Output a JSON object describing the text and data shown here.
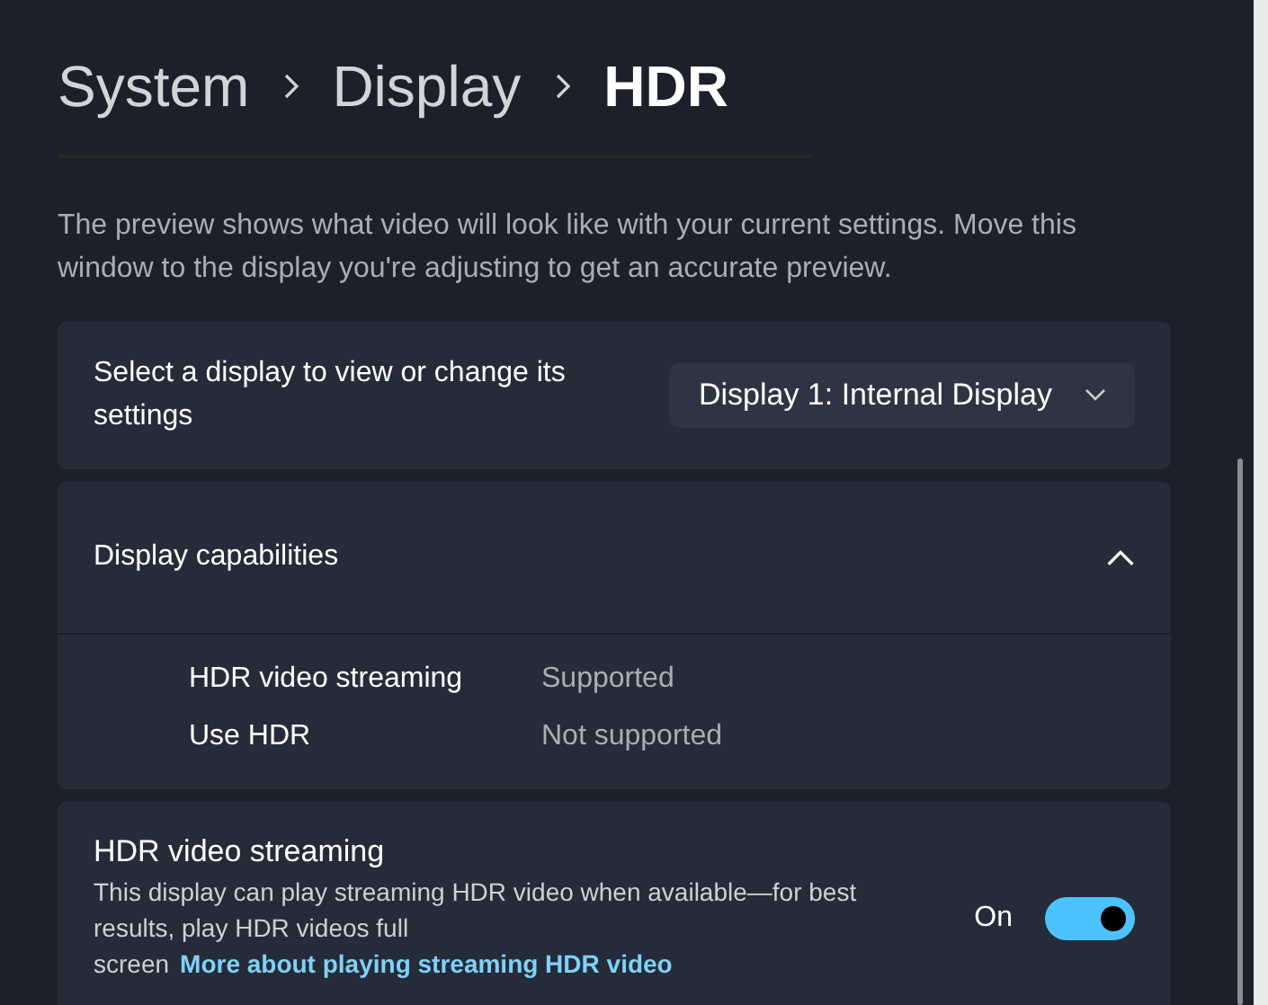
{
  "breadcrumb": [
    {
      "label": "System",
      "current": false
    },
    {
      "label": "Display",
      "current": false
    },
    {
      "label": "HDR",
      "current": true
    }
  ],
  "description": "The preview shows what video will look like with your current settings. Move this window to the display you're adjusting to get an accurate preview.",
  "display_select": {
    "label": "Select a display to view or change its settings",
    "value": "Display 1: Internal Display"
  },
  "capabilities": {
    "title": "Display capabilities",
    "expanded": true,
    "rows": [
      {
        "name": "HDR video streaming",
        "value": "Supported"
      },
      {
        "name": "Use HDR",
        "value": "Not supported"
      }
    ]
  },
  "streaming": {
    "title": "HDR video streaming",
    "description": "This display can play streaming HDR video when available—for best results, play HDR videos full screen",
    "link": "More about playing streaming HDR video",
    "toggle_label": "On",
    "on": true
  }
}
